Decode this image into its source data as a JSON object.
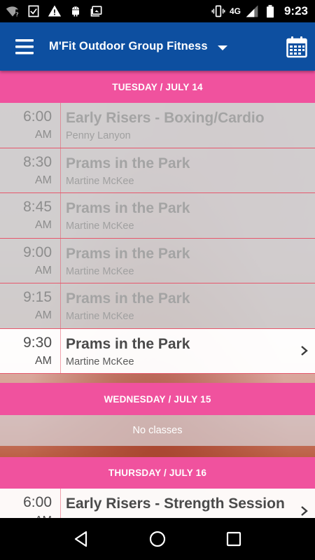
{
  "status_bar": {
    "time": "9:23",
    "network": "4G",
    "left_icons": [
      "wifi-unknown-icon",
      "checkbox-notification-icon",
      "warning-icon",
      "android-icon",
      "photo-notification-icon"
    ],
    "right_icons": [
      "vibrate-icon",
      "signal-icon",
      "battery-icon"
    ]
  },
  "app_bar": {
    "title": "M'Fit Outdoor Group Fitness",
    "left_icon": "menu-icon",
    "right_icon": "calendar-icon"
  },
  "schedule": {
    "days": [
      {
        "header": "TUESDAY / JULY 14",
        "classes": [
          {
            "time": "6:00",
            "ampm": "AM",
            "name": "Early Risers - Boxing/Cardio",
            "instructor": "Penny Lanyon",
            "state": "past"
          },
          {
            "time": "8:30",
            "ampm": "AM",
            "name": "Prams in the Park",
            "instructor": "Martine McKee",
            "state": "past"
          },
          {
            "time": "8:45",
            "ampm": "AM",
            "name": "Prams in the Park",
            "instructor": "Martine McKee",
            "state": "past"
          },
          {
            "time": "9:00",
            "ampm": "AM",
            "name": "Prams in the Park",
            "instructor": "Martine McKee",
            "state": "past"
          },
          {
            "time": "9:15",
            "ampm": "AM",
            "name": "Prams in the Park",
            "instructor": "Martine McKee",
            "state": "past"
          },
          {
            "time": "9:30",
            "ampm": "AM",
            "name": "Prams in the Park",
            "instructor": "Martine McKee",
            "state": "current"
          }
        ]
      },
      {
        "header": "WEDNESDAY / JULY 15",
        "empty_message": "No classes"
      },
      {
        "header": "THURSDAY / JULY 16",
        "classes": [
          {
            "time": "6:00",
            "ampm": "AM",
            "name": "Early Risers - Strength Session",
            "instructor": "",
            "state": "current"
          }
        ]
      }
    ]
  },
  "nav_bar": {
    "buttons": [
      "back-icon",
      "home-icon",
      "recents-icon"
    ]
  },
  "colors": {
    "app_bar": "#0d4fa0",
    "day_header": "#f0529e",
    "row_divider": "#e6576c"
  }
}
